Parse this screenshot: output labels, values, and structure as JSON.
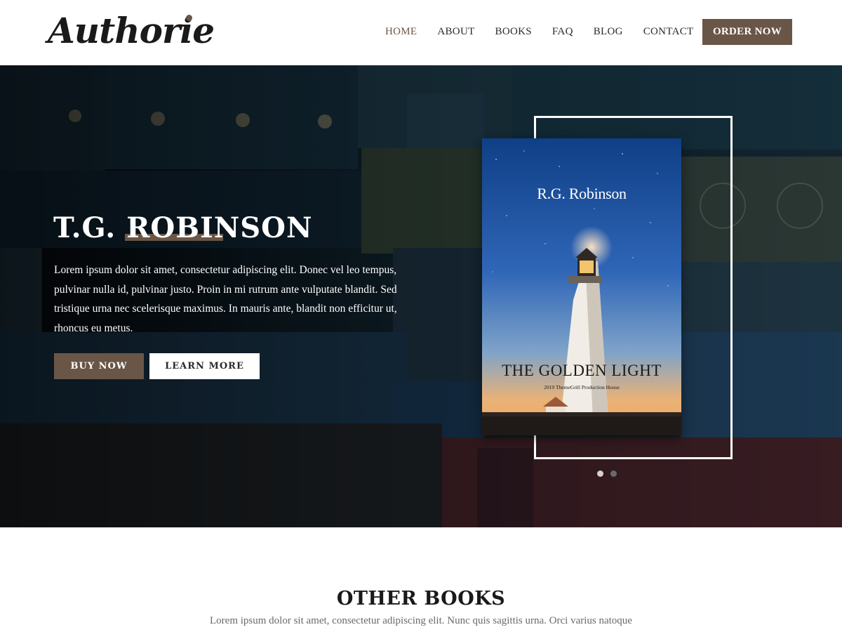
{
  "header": {
    "logo": "Authorie",
    "nav": [
      {
        "label": "HOME",
        "active": true
      },
      {
        "label": "ABOUT",
        "active": false
      },
      {
        "label": "BOOKS",
        "active": false
      },
      {
        "label": "FAQ",
        "active": false
      },
      {
        "label": "BLOG",
        "active": false
      },
      {
        "label": "CONTACT",
        "active": false
      }
    ],
    "order_label": "ORDER NOW"
  },
  "hero": {
    "title": "T.G. ROBINSON",
    "text": "Lorem ipsum dolor sit amet, consectetur adipiscing elit. Donec vel leo tempus, pulvinar nulla id, pulvinar justo. Proin in mi rutrum ante vulputate blandit. Sed tristique urna nec scelerisque maximus. In mauris ante, blandit non efficitur ut, rhoncus eu metus.",
    "buy_label": "BUY NOW",
    "learn_label": "LEARN MORE",
    "book": {
      "author": "R.G. Robinson",
      "title": "THE GOLDEN LIGHT",
      "subtitle": "2019 ThemeGrill Production House"
    },
    "slides": {
      "count": 2,
      "active": 0
    }
  },
  "other_books": {
    "title": "OTHER BOOKS",
    "text": "Lorem ipsum dolor sit amet, consectetur adipiscing elit. Nunc quis sagittis urna. Orci varius natoque"
  },
  "colors": {
    "accent": "#6a5647",
    "white": "#ffffff",
    "text_dark": "#1a1a1a",
    "text_muted": "#6a6a6a"
  }
}
